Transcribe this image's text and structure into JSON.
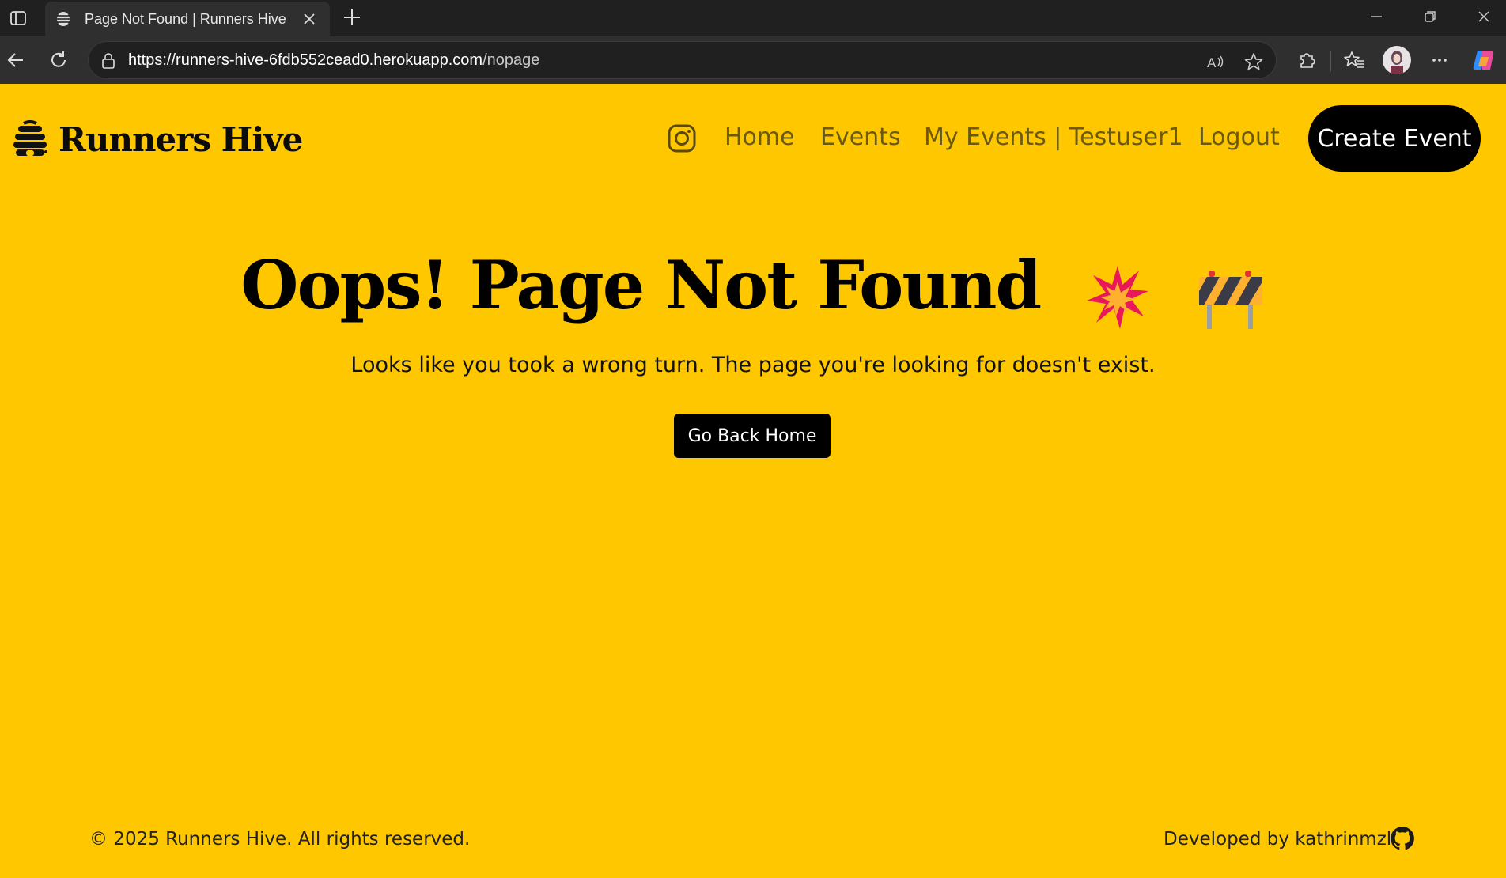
{
  "browser": {
    "tab_title": "Page Not Found | Runners Hive",
    "url_host": "https://runners-hive-6fdb552cead0.herokuapp.com",
    "url_path": "/nopage"
  },
  "navbar": {
    "brand": "Runners Hive",
    "links": [
      "Home",
      "Events",
      "My Events | Testuser1",
      "Logout"
    ],
    "cta": "Create Event"
  },
  "hero": {
    "title": "Oops! Page Not Found",
    "subtitle": "Looks like you took a wrong turn. The page you're looking for doesn't exist.",
    "button": "Go Back Home"
  },
  "footer": {
    "copyright": "© 2025 Runners Hive. All rights reserved.",
    "credit": "Developed by kathrinmzl"
  },
  "icons": [
    "sidebar-icon",
    "hive-favicon",
    "close-icon",
    "plus-icon",
    "minimize-icon",
    "restore-icon",
    "back-icon",
    "reload-icon",
    "lock-icon",
    "read-aloud-icon",
    "star-icon",
    "extensions-icon",
    "favorites-icon",
    "more-icon",
    "copilot-icon",
    "instagram-icon",
    "collision-emoji",
    "construction-emoji",
    "github-icon"
  ],
  "colors": {
    "page_background": "#ffc700",
    "nav_link": "#6a5a10",
    "button_bg": "#000000",
    "button_text": "#ffffff"
  }
}
